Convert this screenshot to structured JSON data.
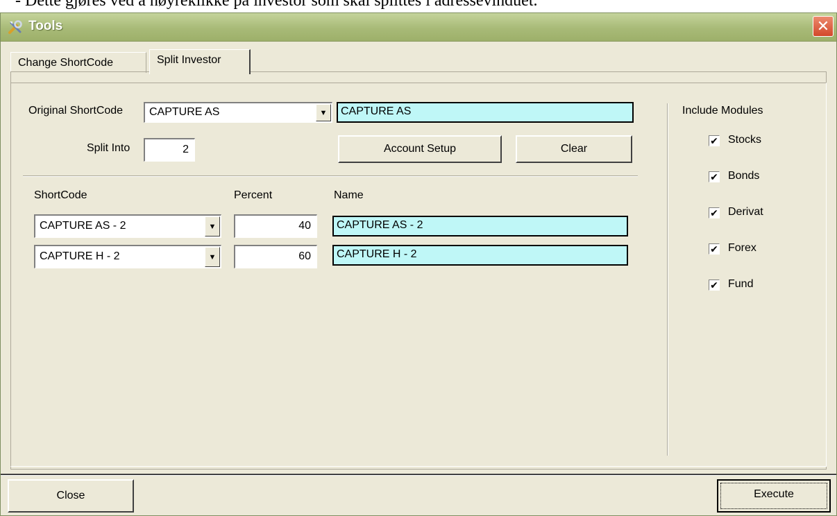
{
  "background_caption": "- Dette gjøres ved å høyreklikke på investor som skal splittes i adressevinduet.",
  "window": {
    "title": "Tools",
    "close_glyph": "✕"
  },
  "tabs": [
    {
      "label": "Change ShortCode",
      "active": false
    },
    {
      "label": "Split Investor",
      "active": true
    }
  ],
  "form": {
    "original_label": "Original ShortCode",
    "original_value": "CAPTURE AS",
    "original_name": "CAPTURE AS",
    "split_label": "Split Into",
    "split_value": "2",
    "account_setup_label": "Account Setup",
    "clear_label": "Clear"
  },
  "table": {
    "headers": {
      "shortcode": "ShortCode",
      "percent": "Percent",
      "name": "Name"
    },
    "rows": [
      {
        "shortcode": "CAPTURE AS - 2",
        "percent": "40",
        "name": "CAPTURE AS - 2"
      },
      {
        "shortcode": "CAPTURE H - 2",
        "percent": "60",
        "name": "CAPTURE H - 2"
      }
    ]
  },
  "modules": {
    "title": "Include Modules",
    "items": [
      {
        "label": "Stocks",
        "checked": true
      },
      {
        "label": "Bonds",
        "checked": true
      },
      {
        "label": "Derivat",
        "checked": true
      },
      {
        "label": "Forex",
        "checked": true
      },
      {
        "label": "Fund",
        "checked": true
      }
    ],
    "check_glyph": "✔"
  },
  "footer": {
    "close_label": "Close",
    "execute_label": "Execute"
  },
  "icons": {
    "dropdown": "▼",
    "title_icon": "tools-icon"
  },
  "colors": {
    "cyan_field": "#bff7f7",
    "titlebar": "#a8ba77",
    "close_red": "#d2482a"
  }
}
